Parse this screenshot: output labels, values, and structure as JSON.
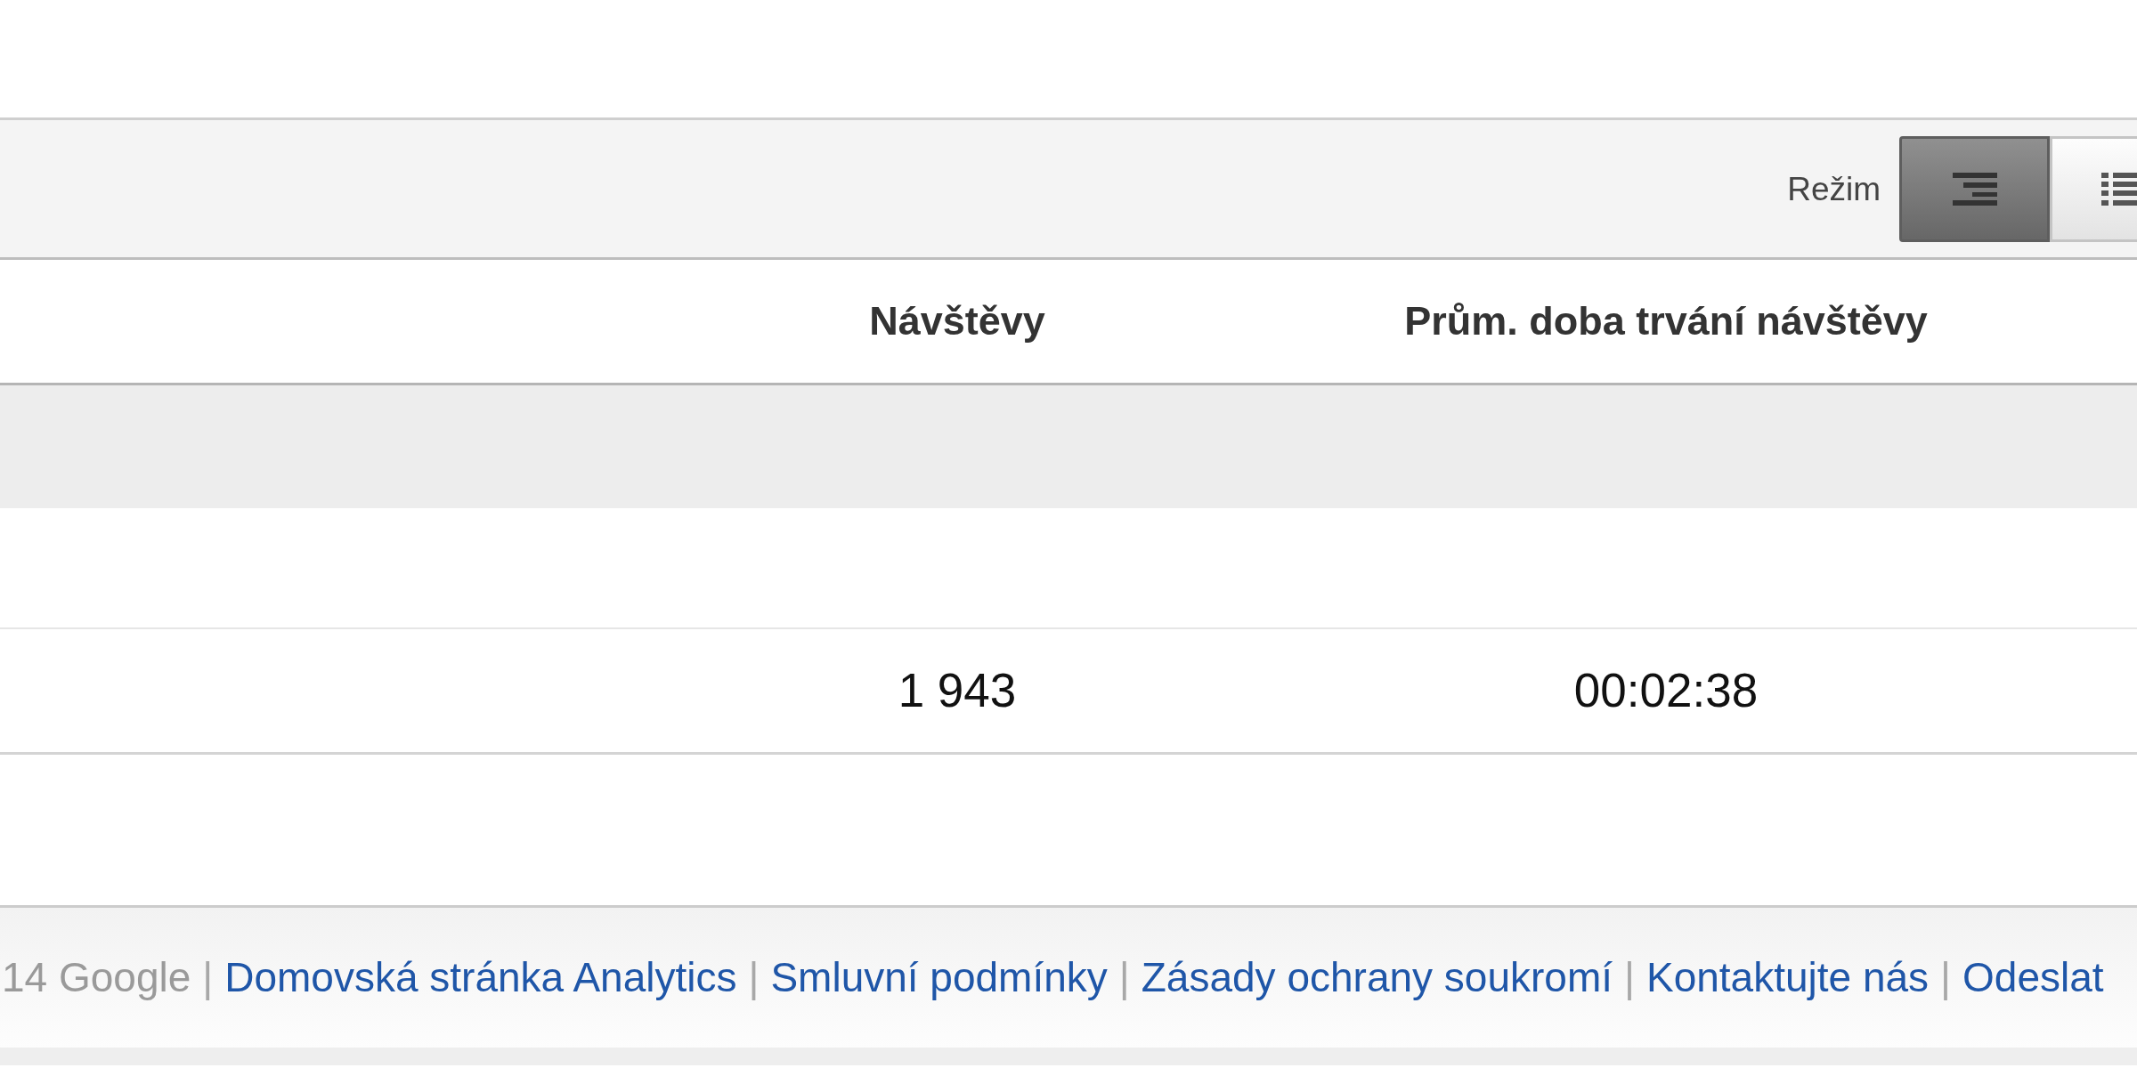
{
  "toolbar": {
    "mode_label": "Režim",
    "mode_buttons": [
      {
        "kind": "indented",
        "selected": true
      },
      {
        "kind": "list",
        "selected": false
      }
    ]
  },
  "table": {
    "columns": [
      {
        "label": "Návštěvy"
      },
      {
        "label": "Prům. doba trvání návštěvy"
      }
    ],
    "rows": [
      {
        "cells": [
          "1 943",
          "00:02:38"
        ]
      }
    ]
  },
  "footer": {
    "items": [
      {
        "kind": "text",
        "text": "14 Google"
      },
      {
        "kind": "separator",
        "text": "|"
      },
      {
        "kind": "link",
        "text": "Domovská stránka Analytics"
      },
      {
        "kind": "separator",
        "text": "|"
      },
      {
        "kind": "link",
        "text": "Smluvní podmínky"
      },
      {
        "kind": "separator",
        "text": "|"
      },
      {
        "kind": "link",
        "text": "Zásady ochrany soukromí"
      },
      {
        "kind": "separator",
        "text": "|"
      },
      {
        "kind": "link",
        "text": "Kontaktujte nás"
      },
      {
        "kind": "separator",
        "text": "|"
      },
      {
        "kind": "link",
        "text": "Odeslat"
      }
    ]
  }
}
